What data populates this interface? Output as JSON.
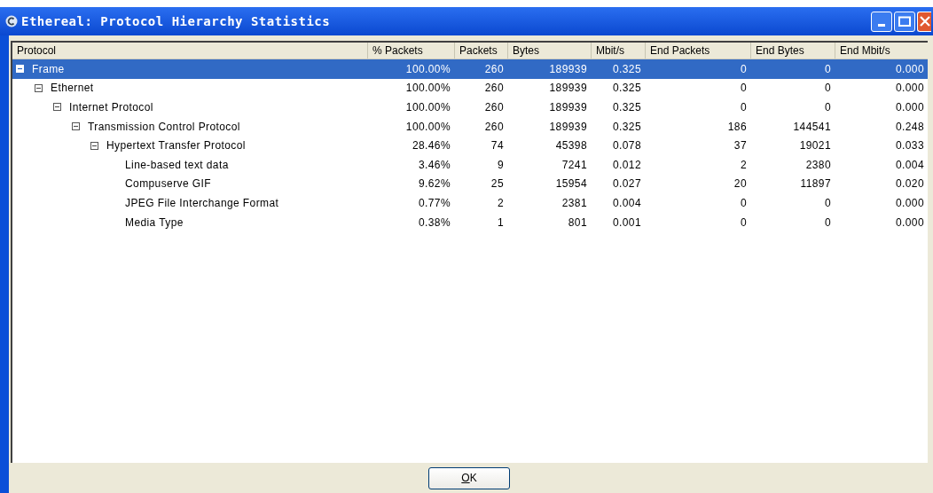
{
  "window": {
    "title": "Ethereal: Protocol Hierarchy Statistics"
  },
  "table": {
    "columns": [
      "Protocol",
      "% Packets",
      "Packets",
      "Bytes",
      "Mbit/s",
      "End Packets",
      "End Bytes",
      "End Mbit/s"
    ],
    "rows": [
      {
        "protocol": "Frame",
        "values": [
          "100.00%",
          "260",
          "189939",
          "0.325",
          "0",
          "0",
          "0.000"
        ],
        "selected": true,
        "expanded": true,
        "children": [
          {
            "protocol": "Ethernet",
            "values": [
              "100.00%",
              "260",
              "189939",
              "0.325",
              "0",
              "0",
              "0.000"
            ],
            "selected": false,
            "expanded": true,
            "children": [
              {
                "protocol": "Internet Protocol",
                "values": [
                  "100.00%",
                  "260",
                  "189939",
                  "0.325",
                  "0",
                  "0",
                  "0.000"
                ],
                "selected": false,
                "expanded": true,
                "children": [
                  {
                    "protocol": "Transmission Control Protocol",
                    "values": [
                      "100.00%",
                      "260",
                      "189939",
                      "0.325",
                      "186",
                      "144541",
                      "0.248"
                    ],
                    "selected": false,
                    "expanded": true,
                    "children": [
                      {
                        "protocol": "Hypertext Transfer Protocol",
                        "values": [
                          "28.46%",
                          "74",
                          "45398",
                          "0.078",
                          "37",
                          "19021",
                          "0.033"
                        ],
                        "selected": false,
                        "expanded": true,
                        "children": [
                          {
                            "protocol": "Line-based text data",
                            "values": [
                              "3.46%",
                              "9",
                              "7241",
                              "0.012",
                              "2",
                              "2380",
                              "0.004"
                            ],
                            "selected": false
                          },
                          {
                            "protocol": "Compuserve GIF",
                            "values": [
                              "9.62%",
                              "25",
                              "15954",
                              "0.027",
                              "20",
                              "11897",
                              "0.020"
                            ],
                            "selected": false
                          },
                          {
                            "protocol": "JPEG File Interchange Format",
                            "values": [
                              "0.77%",
                              "2",
                              "2381",
                              "0.004",
                              "0",
                              "0",
                              "0.000"
                            ],
                            "selected": false
                          },
                          {
                            "protocol": "Media Type",
                            "values": [
                              "0.38%",
                              "1",
                              "801",
                              "0.001",
                              "0",
                              "0",
                              "0.000"
                            ],
                            "selected": false
                          }
                        ]
                      }
                    ]
                  }
                ]
              }
            ]
          }
        ]
      }
    ]
  },
  "buttons": [
    "OK"
  ]
}
